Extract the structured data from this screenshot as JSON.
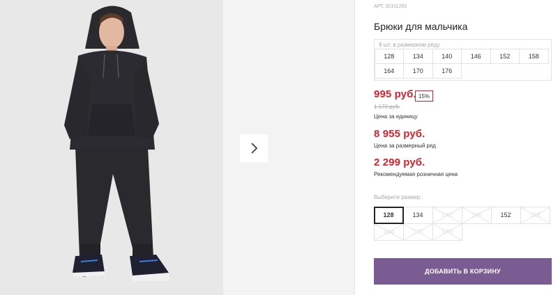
{
  "product": {
    "article_label": "АРТ. 32311263",
    "title": "Брюки для мальчика",
    "image_alt": "boy in dark hoodie and jogger pants"
  },
  "size_range": {
    "caption": "9 шт. в размерном ряду",
    "sizes": [
      "128",
      "134",
      "140",
      "146",
      "152",
      "158",
      "164",
      "170",
      "176"
    ]
  },
  "prices": {
    "unit_price": "995 руб.",
    "discount": "15%",
    "old_price": "1 170 руб.",
    "unit_caption": "Цена за единицу",
    "range_price": "8 955 руб.",
    "range_caption": "Цена за размерный ряд",
    "retail_price": "2 299 руб.",
    "retail_caption": "Рекомендуемая розничная цена",
    "price_color": "#d2232f"
  },
  "size_picker": {
    "label": "Выберите размер:",
    "selected": "128",
    "options": [
      {
        "size": "128",
        "available": true
      },
      {
        "size": "134",
        "available": true
      },
      {
        "size": "140",
        "available": false
      },
      {
        "size": "146",
        "available": false
      },
      {
        "size": "152",
        "available": true
      },
      {
        "size": "158",
        "available": false
      },
      {
        "size": "164",
        "available": false
      },
      {
        "size": "170",
        "available": false
      },
      {
        "size": "176",
        "available": false
      }
    ]
  },
  "cart": {
    "button_label": "ДОБАВИТЬ В КОРЗИНУ",
    "button_color": "#7a5c93"
  },
  "gallery": {
    "next_icon": "chevron-right-icon"
  }
}
